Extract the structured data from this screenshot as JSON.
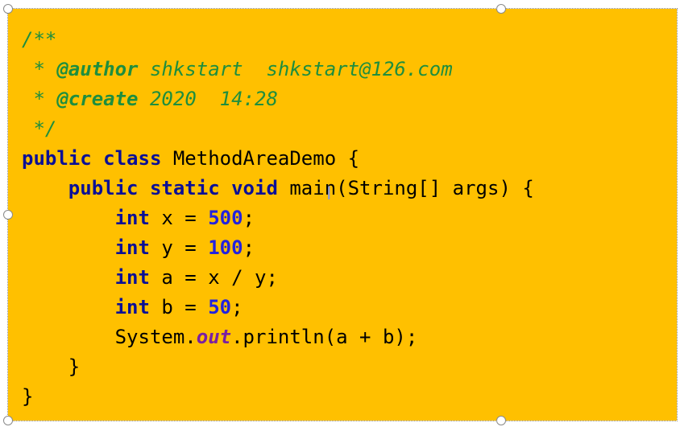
{
  "colors": {
    "box_background": "#FFC000",
    "comment": "#1E8E3E",
    "keyword": "#0A0F96",
    "number": "#2222E0",
    "static_field": "#7A1FA2"
  },
  "code": {
    "comment_open": "/**",
    "author_prefix": " * ",
    "author_tag": "@author",
    "author_value": " shkstart  shkstart@126.com",
    "create_prefix": " * ",
    "create_tag": "@create",
    "create_value": " 2020  14:28",
    "comment_close": " */",
    "class_kw_public": "public",
    "class_kw_class": "class",
    "class_name": " MethodAreaDemo {",
    "main_kw_public": "public",
    "main_kw_static": "static",
    "main_kw_void": "void",
    "main_signature": " main(String[] args) {",
    "decl_x": {
      "type": "int",
      "name": " x = ",
      "value": "500",
      "end": ";"
    },
    "decl_y": {
      "type": "int",
      "name": " y = ",
      "value": "100",
      "end": ";"
    },
    "decl_a": {
      "type": "int",
      "rest": " a = x / y;"
    },
    "decl_b": {
      "type": "int",
      "name": " b = ",
      "value": "50",
      "end": ";"
    },
    "print_system": "System.",
    "print_out": "out",
    "print_rest": ".println(a + b);",
    "close_method": "    }",
    "close_class": "}"
  },
  "cursor_icon": "text-cursor-icon"
}
